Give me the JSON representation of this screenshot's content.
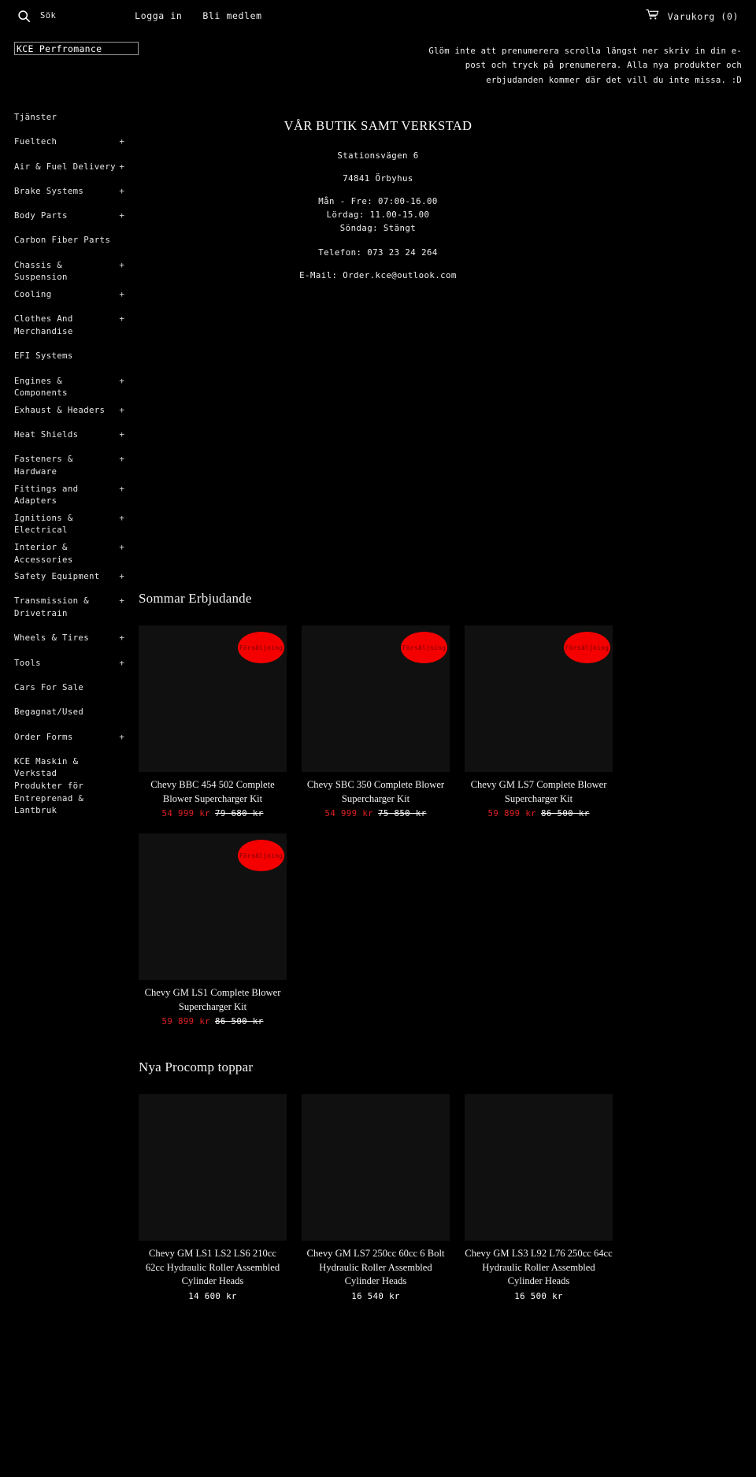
{
  "topbar": {
    "search_icon": "search-icon",
    "search_label": "Sök",
    "login_label": "Logga in",
    "signup_label": "Bli medlem",
    "cart_icon": "shopping-cart-icon",
    "cart_label": "Varukorg (0)"
  },
  "brand": {
    "name": "KCE Perfromance"
  },
  "announcement": {
    "text": "Glöm inte att prenumerera scrolla längst ner skriv in din e-post och tryck på prenumerera. Alla nya produkter och erbjudanden kommer där det vill du inte missa. :D"
  },
  "sidebar": {
    "items": [
      {
        "label": "Tjänster",
        "expand": ""
      },
      {
        "label": "Fueltech",
        "expand": "+"
      },
      {
        "label": "Air & Fuel Delivery",
        "expand": "+"
      },
      {
        "label": "Brake Systems",
        "expand": "+"
      },
      {
        "label": "Body Parts",
        "expand": "+"
      },
      {
        "label": "Carbon Fiber Parts",
        "expand": ""
      },
      {
        "label": "Chassis & Suspension",
        "expand": "+"
      },
      {
        "label": "Cooling",
        "expand": "+"
      },
      {
        "label": "Clothes And\nMerchandise",
        "expand": "+"
      },
      {
        "label": "EFI Systems",
        "expand": ""
      },
      {
        "label": "Engines & Components",
        "expand": "+"
      },
      {
        "label": "Exhaust & Headers",
        "expand": "+"
      },
      {
        "label": "Heat Shields",
        "expand": "+"
      },
      {
        "label": "Fasteners & Hardware",
        "expand": "+"
      },
      {
        "label": "Fittings and Adapters",
        "expand": "+"
      },
      {
        "label": "Ignitions & Electrical",
        "expand": "+"
      },
      {
        "label": "Interior & Accessories",
        "expand": "+"
      },
      {
        "label": "Safety Equipment",
        "expand": "+"
      },
      {
        "label": "Transmission &\nDrivetrain",
        "expand": "+"
      },
      {
        "label": "Wheels & Tires",
        "expand": "+"
      },
      {
        "label": "Tools",
        "expand": "+"
      },
      {
        "label": "Cars For Sale",
        "expand": ""
      },
      {
        "label": "Begagnat/Used",
        "expand": ""
      },
      {
        "label": "Order Forms",
        "expand": "+"
      },
      {
        "label": "KCE Maskin & Verkstad\nProdukter för\nEntreprenad & Lantbruk",
        "expand": ""
      }
    ]
  },
  "store_info": {
    "heading": "VÅR BUTIK SAMT VERKSTAD",
    "street": "Stationsvägen 6",
    "city": "74841 Örbyhus",
    "hours_weekday": "Mån - Fre: 07:00-16.00",
    "hours_saturday": "Lördag: 11.00-15.00",
    "hours_sunday": "Söndag: Stängt",
    "phone": "Telefon: 073 23 24 264",
    "email": "E-Mail: Order.kce@outlook.com"
  },
  "sections": [
    {
      "title": "Sommar Erbjudande",
      "products": [
        {
          "badge": "Försäljning",
          "title": "Chevy BBC 454 502 Complete Blower Supercharger Kit",
          "sale_price": "54 999 kr",
          "old_price": "79 680 kr"
        },
        {
          "badge": "Försäljning",
          "title": "Chevy SBC 350 Complete Blower Supercharger Kit",
          "sale_price": "54 999 kr",
          "old_price": "75 850 kr"
        },
        {
          "badge": "Försäljning",
          "title": "Chevy GM LS7 Complete Blower Supercharger Kit",
          "sale_price": "59 899 kr",
          "old_price": "86 500 kr"
        },
        {
          "badge": "Försäljning",
          "title": "Chevy GM LS1 Complete Blower Supercharger Kit",
          "sale_price": "59 899 kr",
          "old_price": "86 500 kr"
        }
      ]
    },
    {
      "title": "Nya Procomp toppar",
      "products": [
        {
          "badge": "",
          "title": "Chevy GM LS1 LS2 LS6 210cc 62cc Hydraulic Roller Assembled Cylinder Heads",
          "sale_price": "",
          "old_price": "",
          "price": "14 600 kr"
        },
        {
          "badge": "",
          "title": "Chevy GM LS7 250cc 60cc 6 Bolt Hydraulic Roller Assembled Cylinder Heads",
          "sale_price": "",
          "old_price": "",
          "price": "16 540 kr"
        },
        {
          "badge": "",
          "title": "Chevy GM LS3 L92 L76 250cc 64cc Hydraulic Roller Assembled Cylinder Heads",
          "sale_price": "",
          "old_price": "",
          "price": "16 500 kr"
        }
      ]
    }
  ],
  "colors": {
    "background": "#000000",
    "card": "#101010",
    "sale_red": "#e02020",
    "badge_red": "#f50000"
  }
}
